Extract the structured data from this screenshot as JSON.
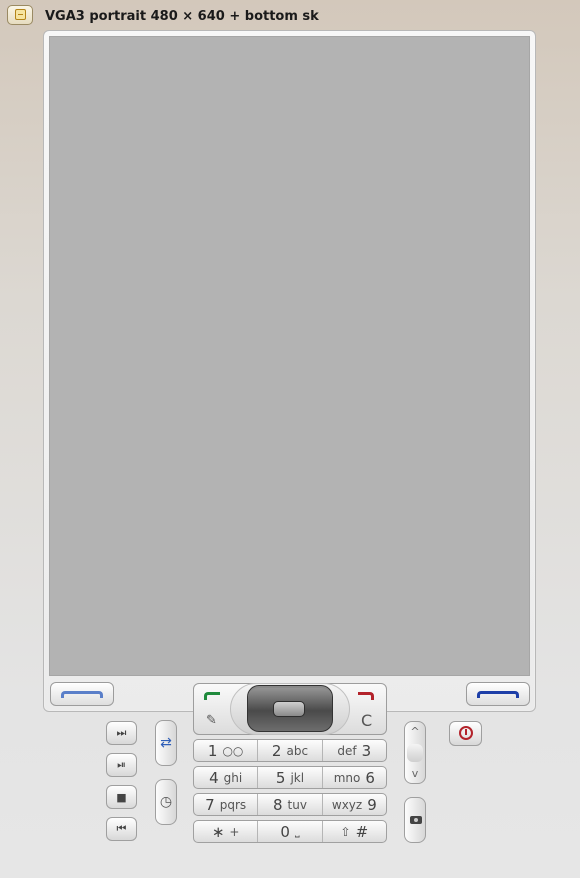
{
  "window": {
    "title": "VGA3 portrait 480 × 640 + bottom sk"
  },
  "keypad": {
    "rows": [
      [
        {
          "main": "1",
          "sub": "○○",
          "pre": ""
        },
        {
          "main": "2",
          "sub": "abc",
          "pre": ""
        },
        {
          "main": "3",
          "sub": "",
          "pre": "def"
        }
      ],
      [
        {
          "main": "4",
          "sub": "ghi",
          "pre": ""
        },
        {
          "main": "5",
          "sub": "jkl",
          "pre": ""
        },
        {
          "main": "6",
          "sub": "",
          "pre": "mno"
        }
      ],
      [
        {
          "main": "7",
          "sub": "pqrs",
          "pre": ""
        },
        {
          "main": "8",
          "sub": "tuv",
          "pre": ""
        },
        {
          "main": "9",
          "sub": "",
          "pre": "wxyz"
        }
      ],
      [
        {
          "main": "∗",
          "sub": "+",
          "pre": ""
        },
        {
          "main": "0",
          "sub": "⎵",
          "pre": ""
        },
        {
          "main": "#",
          "sub": "",
          "pre": "⇧"
        }
      ]
    ],
    "clear_label": "C"
  },
  "media": {
    "next": "⏭",
    "play_pause": "⏯",
    "stop": "■",
    "previous": "⏮"
  },
  "side": {
    "menu": "⇄",
    "clock": "◷",
    "vol_up": "^",
    "vol_down": "v"
  },
  "colors": {
    "screen": "#b3b3b3",
    "call": "#1f8a3c",
    "end": "#b3232b",
    "left_softkey": "#5a7fc9",
    "right_softkey": "#1e3fa8"
  }
}
